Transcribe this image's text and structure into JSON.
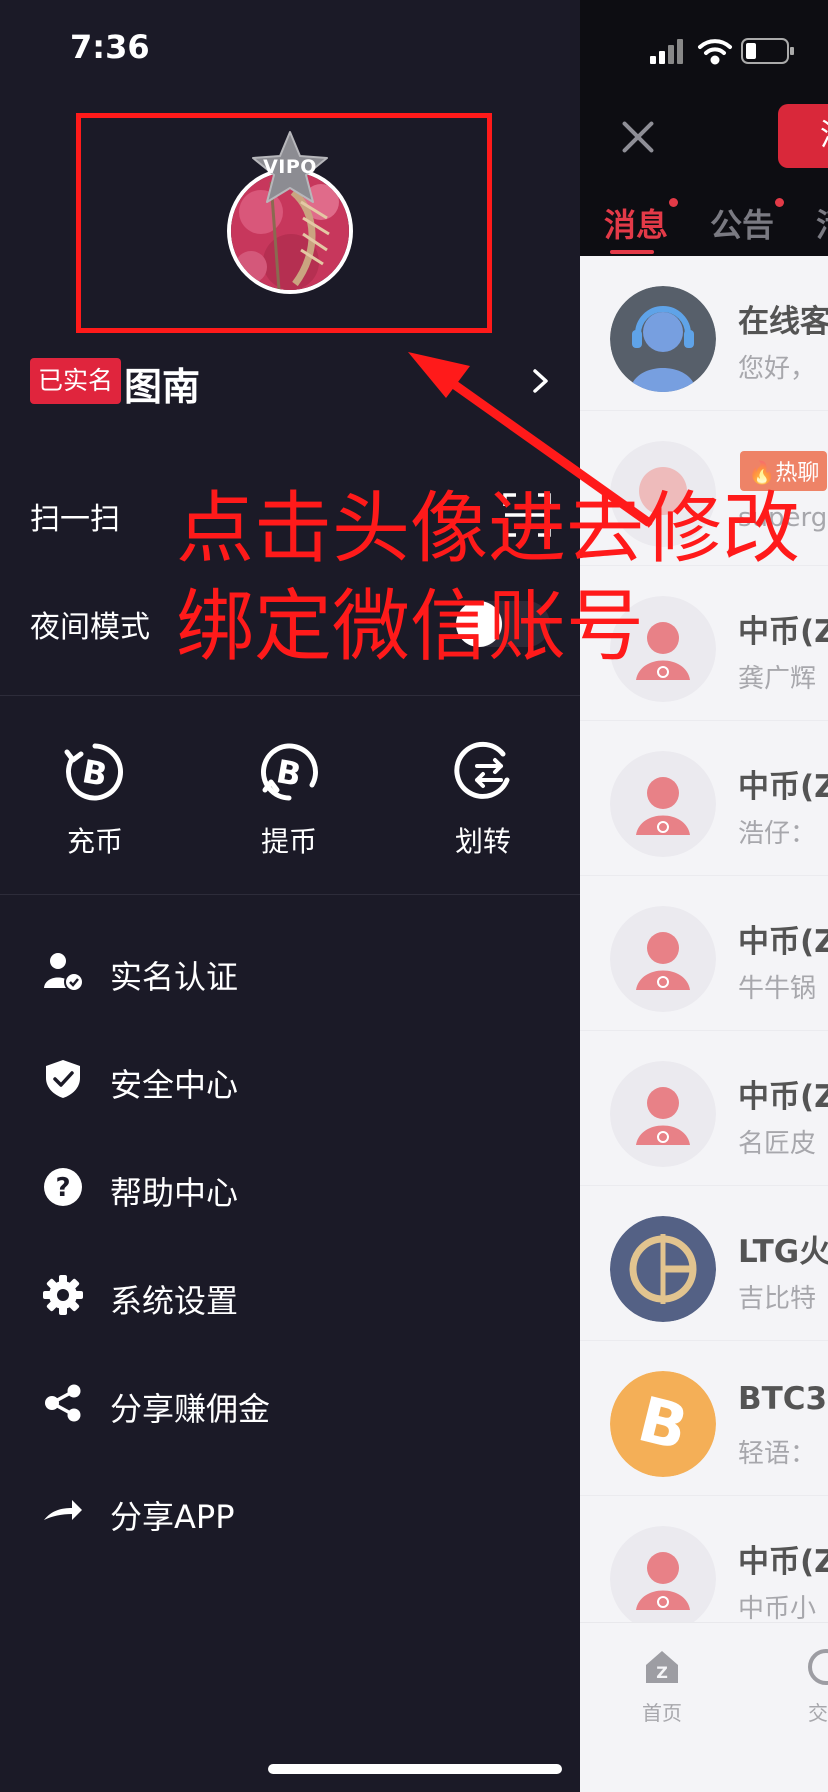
{
  "status_bar": {
    "time": "7:36"
  },
  "drawer": {
    "vip_badge": "VIPO",
    "verified_badge": "已实名",
    "user_name": "图南",
    "settings": [
      {
        "label": "扫一扫",
        "icon": "scan-icon"
      },
      {
        "label": "夜间模式",
        "icon": "toggle-switch",
        "toggle_on": false
      }
    ],
    "actions": [
      {
        "label": "充币",
        "icon": "bitcoin-deposit-icon"
      },
      {
        "label": "提币",
        "icon": "bitcoin-withdraw-icon"
      },
      {
        "label": "划转",
        "icon": "transfer-icon"
      }
    ],
    "menu": [
      {
        "label": "实名认证",
        "icon": "user-verified-icon"
      },
      {
        "label": "安全中心",
        "icon": "shield-check-icon"
      },
      {
        "label": "帮助中心",
        "icon": "question-icon"
      },
      {
        "label": "系统设置",
        "icon": "gear-icon"
      },
      {
        "label": "分享赚佣金",
        "icon": "share-icon"
      },
      {
        "label": "分享APP",
        "icon": "share-arrow-icon"
      }
    ]
  },
  "annotation": {
    "line1": "点击头像进去修改",
    "line2": "绑定微信账号",
    "color": "#ff1a1a"
  },
  "background_page": {
    "button_label": "消",
    "tabs": [
      {
        "label": "消息",
        "active": true,
        "dot": true
      },
      {
        "label": "公告",
        "active": false,
        "dot": true
      },
      {
        "label": "活",
        "active": false,
        "dot": false
      }
    ],
    "conversations": [
      {
        "title": "在线客",
        "subtitle": "您好，",
        "avatar": "support-agent-avatar"
      },
      {
        "title": "",
        "subtitle": "superg",
        "badge": "热聊",
        "avatar": "group-avatar"
      },
      {
        "title": "中币(Z",
        "subtitle": "龚广辉",
        "avatar": "group-avatar"
      },
      {
        "title": "中币(Z",
        "subtitle": "浩仔：",
        "avatar": "group-avatar"
      },
      {
        "title": "中币(Z",
        "subtitle": "牛牛锅",
        "avatar": "group-avatar"
      },
      {
        "title": "中币(Z",
        "subtitle": "名匠皮",
        "avatar": "group-avatar"
      },
      {
        "title": "LTG火",
        "subtitle": "吉比特",
        "avatar": "ltg-coin-avatar"
      },
      {
        "title": "BTC3",
        "subtitle": "轻语：",
        "avatar": "bitcoin-avatar"
      },
      {
        "title": "中币(Z",
        "subtitle": "中币小",
        "avatar": "group-avatar"
      }
    ],
    "bottom_nav": [
      {
        "label": "首页",
        "icon": "home-icon"
      },
      {
        "label": "交",
        "icon": "trade-icon"
      }
    ],
    "accent_color": "#e33a48"
  }
}
